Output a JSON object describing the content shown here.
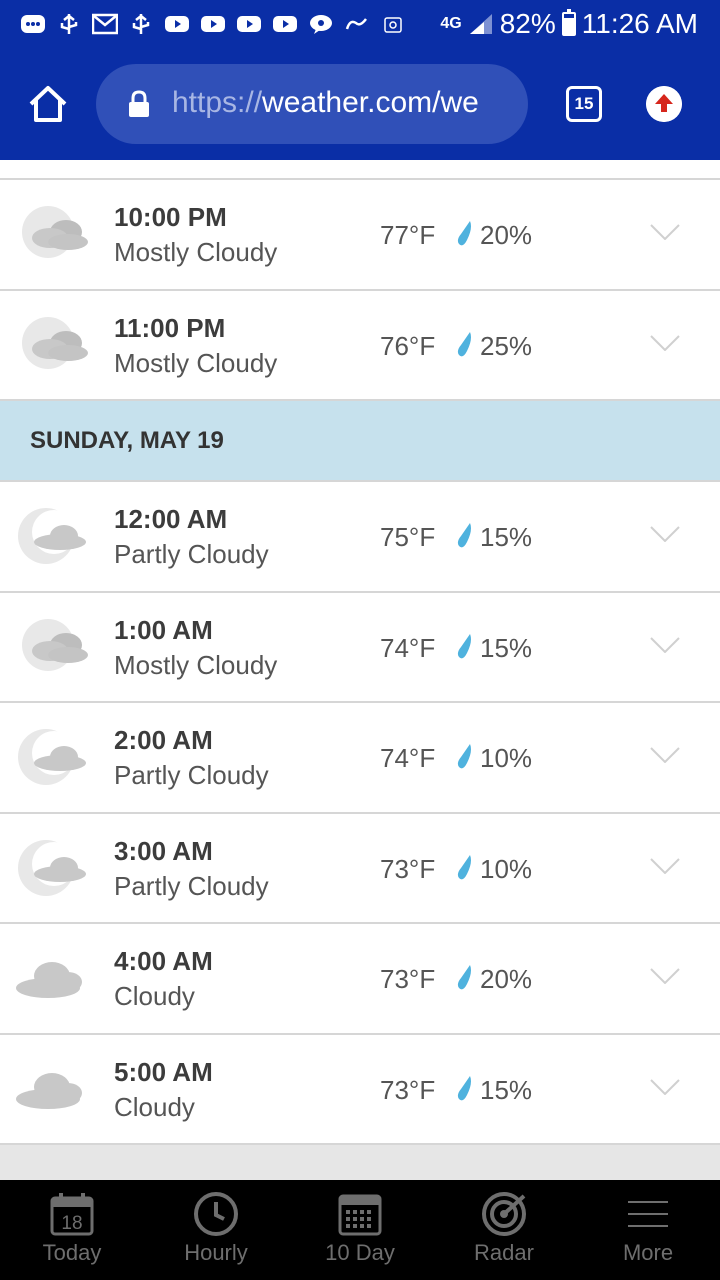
{
  "status_bar": {
    "network": "4G",
    "battery": "82%",
    "time": "11:26 AM"
  },
  "browser": {
    "url_protocol": "https://",
    "url_rest": "weather.com/we",
    "tab_count": "15"
  },
  "hourly": [
    {
      "time": "10:00 PM",
      "condition": "Mostly Cloudy",
      "temp": "77°F",
      "precip": "20%",
      "icon": "mostly-cloudy-night-icon"
    },
    {
      "time": "11:00 PM",
      "condition": "Mostly Cloudy",
      "temp": "76°F",
      "precip": "25%",
      "icon": "mostly-cloudy-night-icon"
    }
  ],
  "day_header": "SUNDAY, MAY 19",
  "hourly_next": [
    {
      "time": "12:00 AM",
      "condition": "Partly Cloudy",
      "temp": "75°F",
      "precip": "15%",
      "icon": "partly-cloudy-night-icon"
    },
    {
      "time": "1:00 AM",
      "condition": "Mostly Cloudy",
      "temp": "74°F",
      "precip": "15%",
      "icon": "mostly-cloudy-night-icon"
    },
    {
      "time": "2:00 AM",
      "condition": "Partly Cloudy",
      "temp": "74°F",
      "precip": "10%",
      "icon": "partly-cloudy-night-icon"
    },
    {
      "time": "3:00 AM",
      "condition": "Partly Cloudy",
      "temp": "73°F",
      "precip": "10%",
      "icon": "partly-cloudy-night-icon"
    },
    {
      "time": "4:00 AM",
      "condition": "Cloudy",
      "temp": "73°F",
      "precip": "20%",
      "icon": "cloudy-icon"
    },
    {
      "time": "5:00 AM",
      "condition": "Cloudy",
      "temp": "73°F",
      "precip": "15%",
      "icon": "cloudy-icon"
    }
  ],
  "bottom_nav": {
    "today": "Today",
    "today_date": "18",
    "hourly": "Hourly",
    "ten_day": "10 Day",
    "radar": "Radar",
    "more": "More"
  },
  "colors": {
    "brand": "#0a2ea6",
    "day_header": "#c6e1ed",
    "precip_drop": "#4fb2de"
  }
}
